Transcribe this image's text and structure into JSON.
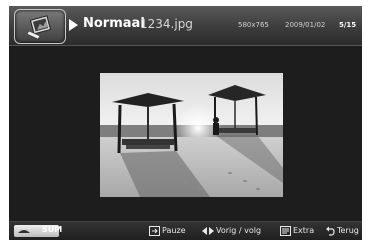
{
  "header": {
    "mode": "Normaal",
    "filename": "1234.jpg",
    "resolution": "580x765",
    "date": "2009/01/02",
    "counter": "5/15",
    "icons": {
      "app": "photo-frame-icon",
      "play": "play-arrow-icon"
    }
  },
  "footer": {
    "sum_label": "SUM",
    "pause_label": "Pauze",
    "prev_next_label": "Vorig / volg",
    "extra_label": "Extra",
    "back_label": "Terug",
    "icons": {
      "sum": "remote-key-icon",
      "pause": "pause-icon",
      "prev_next": "left-right-arrows-icon",
      "extra": "tools-icon",
      "back": "return-arrow-icon"
    }
  },
  "photo": {
    "subject": "beach-huts-photo"
  }
}
